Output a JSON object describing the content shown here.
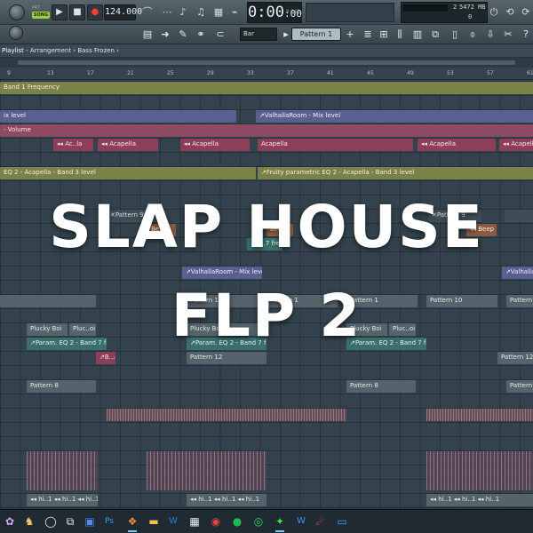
{
  "toolbar": {
    "pattern_mode_label": "PAT",
    "song_mode_label": "SONG",
    "play_glyph": "▶",
    "stop_glyph": "■",
    "record_glyph": "●",
    "tempo": "124.000",
    "time_main": "0:00",
    "time_sub": ":00",
    "time_unit": "M:S:CS",
    "cpu_value": "2",
    "ram_value": "5472 MB",
    "polyphony_value": "0",
    "snap_value": "Bar",
    "pattern_selector": "Pattern 1",
    "pattern_add": "+"
  },
  "title_bar": {
    "window": "Playlist",
    "path": " - Arrangement",
    "sep": " › ",
    "current": "Bass Frozen",
    "arrow": " ›"
  },
  "ruler": {
    "bars": [
      "9",
      "13",
      "17",
      "21",
      "25",
      "29",
      "33",
      "37",
      "41",
      "45",
      "49",
      "53",
      "57",
      "61"
    ]
  },
  "clips": {
    "band1_freq": "Band 1 Frequency",
    "mix_level_left": "ix level",
    "valhalla_mix_1": "↗ValhallaRoom - Mix level",
    "volume": "- Volume",
    "acapella_1": "◂◂ Ac..la",
    "acapella_2": "◂◂ Acapella",
    "acapella_3": "◂◂ Acapella",
    "acapella_4": "Acapella",
    "acapella_5": "◂◂ Acapella",
    "acapella_6": "◂◂ Acapella",
    "eq2_left": "EQ 2 - Acapella - Band 3 level",
    "eq2_right": "↗Fruity parametric EQ 2 - Acapella - Band 3 level",
    "pattern_x1": "✕Pattern 9",
    "pattern_x2": "✕Pattern 9",
    "beep_1": "Be..",
    "beep_2": "Beep",
    "beep_3": "◂◂ Beep",
    "para_7": "↗a...7 freq",
    "valhalla_mix_2": "↗ValhallaRoom - Mix level",
    "valhalla_mix_3": "↗ValhallaR",
    "pattern1_a": "Pattern 1",
    "pattern1_b": "Pattern 1",
    "pattern1_c": "Pattern 1",
    "pattern10": "Pattern 10",
    "pattern_61": "Pattern 61",
    "plucky_1": "Plucky Boi",
    "plucky_2": "Pluc..oi",
    "plucky_3": "Plucky Boi",
    "plucky_4": "Plucky Boi",
    "plucky_5": "Pluc..oi",
    "param_eq_1": "↗Param. EQ 2 - Band 7 freq",
    "param_eq_2": "↗Param. EQ 2 - Band 7 freq",
    "param_eq_3": "↗Param. EQ 2 - Band 7 freq",
    "be_small": "↗B...e",
    "pattern12_a": "Pattern 12",
    "pattern12_b": "Pattern 12",
    "pattern8_a": "Pattern 8",
    "pattern8_b": "Pattern 8",
    "pattern8_c": "Pattern 8",
    "hi_row_1": "◂◂ hi..1 ◂◂ hi..1 ◂◂ hi..1",
    "hi_row_2": "◂◂ hi..1 ◂◂ hi..1 ◂◂ hi..1",
    "hi_row_3": "◂◂ hi..1 ◂◂ hi..1 ◂◂ hi..1"
  },
  "overlay": {
    "line1": "SLAP HOUSE",
    "line2": "FLP 2"
  },
  "taskbar": {
    "apps": [
      "start",
      "search",
      "task-view",
      "zoom",
      "photoshop",
      "fl-studio",
      "file-explorer",
      "word",
      "store",
      "chrome",
      "spotify",
      "whatsapp",
      "fl-studio-2",
      "wavepad",
      "nox",
      "mail"
    ]
  },
  "colors": {
    "song_mode": "#9ad13a",
    "record": "#ff3b3b",
    "grid_bg": "#33424c",
    "overlay_text": "#ffffff"
  }
}
